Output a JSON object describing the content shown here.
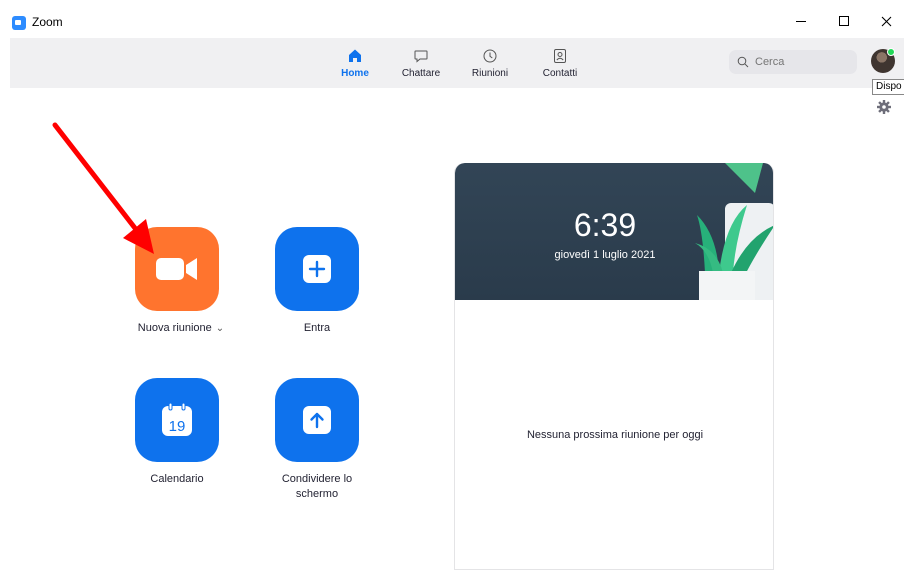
{
  "window": {
    "title": "Zoom"
  },
  "nav": {
    "tabs": [
      {
        "label": "Home",
        "icon": "home-icon",
        "active": true
      },
      {
        "label": "Chattare",
        "icon": "chat-icon"
      },
      {
        "label": "Riunioni",
        "icon": "clock-icon"
      },
      {
        "label": "Contatti",
        "icon": "contacts-icon"
      }
    ],
    "search_placeholder": "Cerca",
    "tooltip": "Dispo"
  },
  "actions": {
    "new_meeting": {
      "label": "Nuova riunione",
      "icon": "video-camera-icon",
      "color": "#ff742e"
    },
    "join": {
      "label": "Entra",
      "icon": "plus-icon",
      "color": "#0e72ed"
    },
    "schedule": {
      "label": "Calendario",
      "icon": "calendar-icon",
      "day": "19",
      "color": "#0e72ed"
    },
    "share": {
      "label": "Condividere lo schermo",
      "icon": "arrow-up-icon",
      "color": "#0e72ed"
    }
  },
  "panel": {
    "time": "6:39",
    "date": "giovedì 1 luglio 2021",
    "empty_message": "Nessuna prossima riunione per oggi"
  },
  "colors": {
    "accent": "#0e72ed",
    "orange": "#ff742e",
    "status_online": "#23d959",
    "annotation": "#ff0000"
  }
}
